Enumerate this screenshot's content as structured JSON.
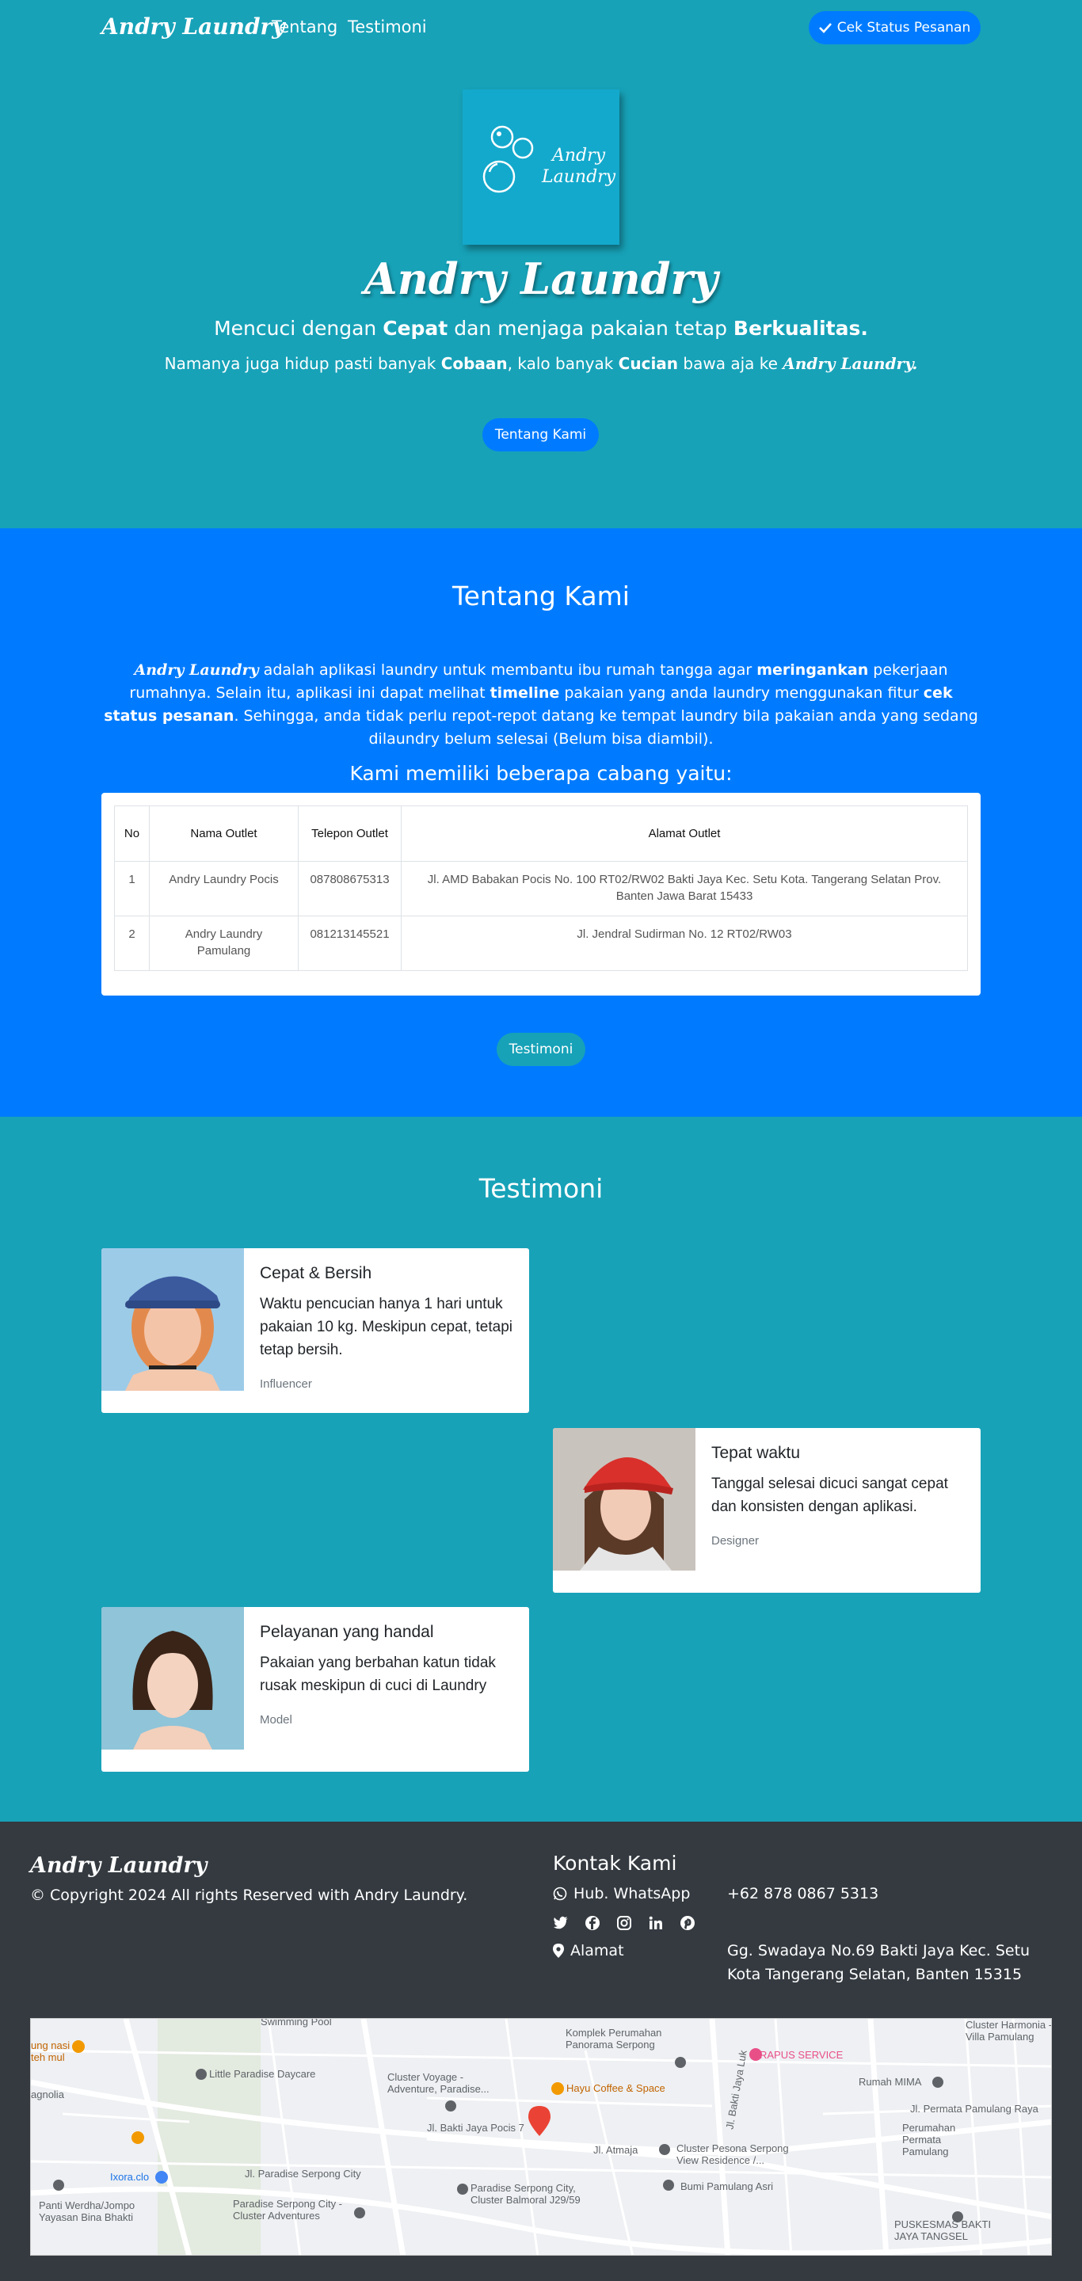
{
  "nav": {
    "brand": "Andry Laundry",
    "links": [
      "Tentang",
      "Testimoni"
    ],
    "status_button": "Cek Status Pesanan"
  },
  "hero": {
    "logo_text_1": "Andry",
    "logo_text_2": "Laundry",
    "title": "Andry Laundry",
    "line1_a": "Mencuci dengan ",
    "line1_b": "Cepat",
    "line1_c": " dan menjaga pakaian tetap ",
    "line1_d": "Berkualitas.",
    "line2_a": "Namanya juga hidup pasti banyak ",
    "line2_b": "Cobaan",
    "line2_c": ", kalo banyak ",
    "line2_d": "Cucian",
    "line2_e": " bawa aja ke ",
    "line2_f": "Andry Laundry.",
    "button": "Tentang Kami"
  },
  "about": {
    "title": "Tentang Kami",
    "desc_brand": "Andry Laundry",
    "desc_1": " adalah aplikasi laundry untuk membantu ibu rumah tangga agar ",
    "desc_2": "meringankan",
    "desc_3": " pekerjaan rumahnya. Selain itu, aplikasi ini dapat melihat ",
    "desc_4": "timeline",
    "desc_5": " pakaian yang anda laundry menggunakan fitur ",
    "desc_6": "cek status pesanan",
    "desc_7": ". Sehingga, anda tidak perlu repot-repot datang ke tempat laundry bila pakaian anda yang sedang dilaundry belum selesai (Belum bisa diambil).",
    "subtitle": "Kami memiliki beberapa cabang yaitu:",
    "table": {
      "headers": [
        "No",
        "Nama Outlet",
        "Telepon Outlet",
        "Alamat Outlet"
      ],
      "rows": [
        [
          "1",
          "Andry Laundry Pocis",
          "087808675313",
          "Jl. AMD Babakan Pocis No. 100 RT02/RW02 Bakti Jaya Kec. Setu Kota. Tangerang Selatan Prov. Banten Jawa Barat 15433"
        ],
        [
          "2",
          "Andry Laundry Pamulang",
          "081213145521",
          "Jl. Jendral Sudirman No. 12 RT02/RW03"
        ]
      ]
    },
    "button": "Testimoni"
  },
  "testimonials": {
    "title": "Testimoni",
    "items": [
      {
        "title": "Cepat & Bersih",
        "text": "Waktu pencucian hanya 1 hari untuk pakaian 10 kg. Meskipun cepat, tetapi tetap bersih.",
        "role": "Influencer"
      },
      {
        "title": "Tepat waktu",
        "text": "Tanggal selesai dicuci sangat cepat dan konsisten dengan aplikasi.",
        "role": "Designer"
      },
      {
        "title": "Pelayanan yang handal",
        "text": "Pakaian yang berbahan katun tidak rusak meskipun di cuci di Laundry",
        "role": "Model"
      }
    ]
  },
  "footer": {
    "brand": "Andry Laundry",
    "copyright": "© Copyright 2024 All rights Reserved with Andry Laundry.",
    "contact_title": "Kontak Kami",
    "whatsapp_label": "Hub. WhatsApp",
    "whatsapp_value": "+62 878 0867 5313",
    "address_label": "Alamat",
    "address_value": "Gg. Swadaya No.69 Bakti Jaya Kec. Setu Kota Tangerang Selatan, Banten 15315"
  },
  "map": {
    "labels": [
      "Swimming Pool",
      "Komplek Perumahan Panorama Serpong",
      "RAPUS SERVICE",
      "Cluster Harmonia - Villa Pamulang",
      "Little Paradise Daycare",
      "Cluster Voyage - Adventure, Paradise...",
      "Hayu Coffee & Space",
      "Rumah MIMA",
      "Jl. Permata Pamulang Raya",
      "Perumahan Permata Pamulang",
      "Jl. Bakti Jaya Pocis 7",
      "Jl. Atmaja",
      "Cluster Pesona Serpong View Residence /...",
      "Jl. Paradise Serpong City",
      "Ixora.clo",
      "Paradise Serpong City, Cluster Balmoral J29/59",
      "Bumi Pamulang Asri",
      "Paradise Serpong City - Cluster Adventures",
      "Panti Werdha/Jompo Yayasan Bina Bhakti",
      "PUSKESMAS BAKTI JAYA TANGSEL",
      "ung nasi teh mul",
      "agnolia",
      "Jl. Bakti Jaya Luk"
    ]
  },
  "colors": {
    "teal": "#17a2b8",
    "blue": "#007bff",
    "dark": "#343a40"
  }
}
